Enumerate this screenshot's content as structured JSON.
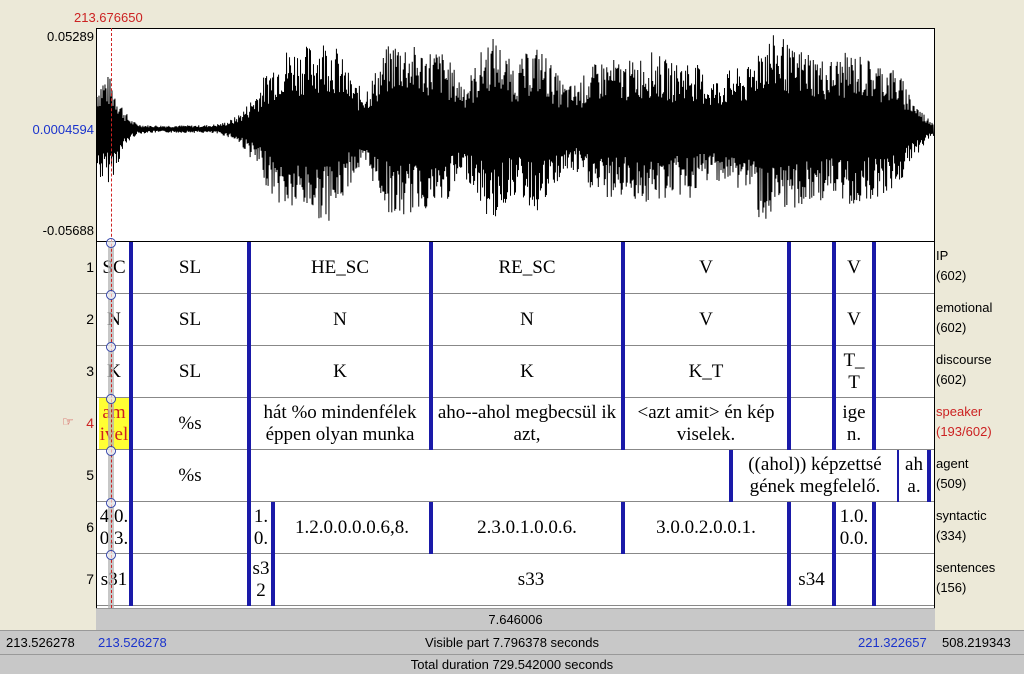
{
  "cursor_time": "213.676650",
  "waveform": {
    "y_max": "0.05289",
    "y_mid": "0.0004594",
    "y_min": "-0.05688"
  },
  "tiers": [
    {
      "num": "1",
      "name": "IP",
      "count": "(602)",
      "intervals": [
        "SC",
        "SL",
        "HE_SC",
        "RE_SC",
        "V",
        "",
        "V",
        ""
      ]
    },
    {
      "num": "2",
      "name": "emotional",
      "count": "(602)",
      "intervals": [
        "N",
        "SL",
        "N",
        "N",
        "V",
        "",
        "V",
        ""
      ]
    },
    {
      "num": "3",
      "name": "discourse",
      "count": "(602)",
      "intervals": [
        "K",
        "SL",
        "K",
        "K",
        "K_T",
        "",
        "T_\nT",
        ""
      ]
    },
    {
      "num": "4",
      "name": "speaker",
      "count": "(193/602)",
      "active": true,
      "intervals": [
        "am ivel",
        "%s",
        "hát %o mindenfélek éppen olyan munka",
        "aho--ahol megbecsül ik azt,",
        "<azt amit> én kép viselek.",
        "",
        "ige n.",
        ""
      ]
    },
    {
      "num": "5",
      "name": "agent",
      "count": "(509)",
      "intervals": [
        "",
        "%s",
        "",
        "((ahol)) képzettsé gének megfelelő.",
        "ah a.",
        ""
      ]
    },
    {
      "num": "6",
      "name": "syntactic",
      "count": "(334)",
      "intervals": [
        "4.0. 0.3.",
        "",
        "1. 0.",
        "1.2.0.0.0.0.6,8.",
        "2.3.0.1.0.0.6.",
        "3.0.0.2.0.0.1.",
        "",
        "1.0. 0.0.",
        ""
      ]
    },
    {
      "num": "7",
      "name": "sentences",
      "count": "(156)",
      "intervals": [
        "s31",
        "",
        "s3 2",
        "s33",
        "s34",
        ""
      ]
    }
  ],
  "selection_duration": "7.646006",
  "window": {
    "left_edge": "213.526278",
    "visible_start": "213.526278",
    "visible_label": "Visible part 7.796378 seconds",
    "visible_end": "221.322657",
    "right_edge": "508.219343"
  },
  "total_label": "Total duration 729.542000 seconds"
}
